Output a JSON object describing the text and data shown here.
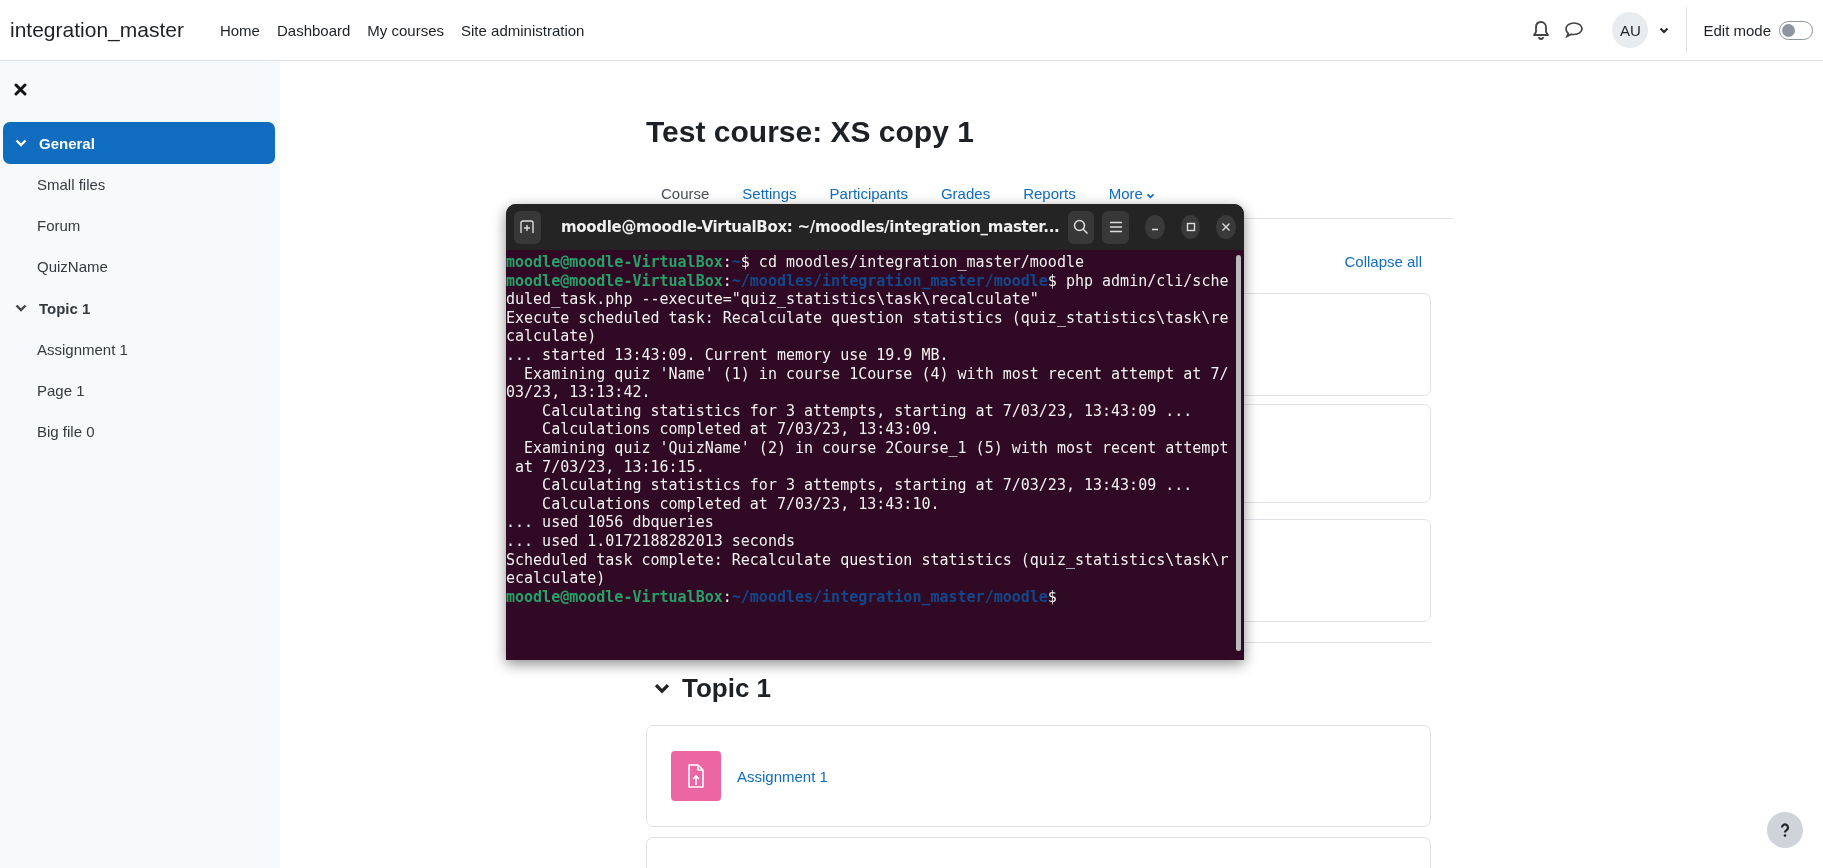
{
  "navbar": {
    "site_name": "integration_master",
    "links": [
      "Home",
      "Dashboard",
      "My courses",
      "Site administration"
    ],
    "avatar": "AU",
    "edit_mode": {
      "label": "Edit mode",
      "on": false
    }
  },
  "sidebar": {
    "sections": [
      {
        "title": "General",
        "expanded": true,
        "selected": true,
        "items": [
          "Small files",
          "Forum",
          "QuizName"
        ]
      },
      {
        "title": "Topic 1",
        "expanded": true,
        "selected": false,
        "items": [
          "Assignment 1",
          "Page 1",
          "Big file 0"
        ]
      }
    ]
  },
  "course": {
    "title": "Test course: XS copy 1",
    "tabs": [
      {
        "label": "Course",
        "selected": true
      },
      {
        "label": "Settings",
        "selected": false
      },
      {
        "label": "Participants",
        "selected": false
      },
      {
        "label": "Grades",
        "selected": false
      },
      {
        "label": "Reports",
        "selected": false
      },
      {
        "label": "More",
        "selected": false
      }
    ],
    "collapse_all": "Collapse all",
    "topic": {
      "title": "Topic 1",
      "expanded": true,
      "activities": [
        {
          "name": "Assignment 1",
          "kind": "assignment"
        }
      ]
    }
  },
  "terminal": {
    "title": "moodle@moodle-VirtualBox: ~/moodles/integration_master...",
    "lines": [
      {
        "kind": "prompt",
        "user": "moodle@moodle-VirtualBox",
        "sep": ":",
        "path": "~",
        "symbol": "$",
        "command": " cd moodles/integration_master/moodle"
      },
      {
        "kind": "prompt",
        "user": "moodle@moodle-VirtualBox",
        "sep": ":",
        "path": "~/moodles/integration_master/moodle",
        "symbol": "$",
        "command": " php admin/cli/sche"
      },
      {
        "kind": "output",
        "text": "duled_task.php --execute=\"quiz_statistics\\task\\recalculate\""
      },
      {
        "kind": "output",
        "text": "Execute scheduled task: Recalculate question statistics (quiz_statistics\\task\\re"
      },
      {
        "kind": "output",
        "text": "calculate)"
      },
      {
        "kind": "output",
        "text": "... started 13:43:09. Current memory use 19.9 MB."
      },
      {
        "kind": "output",
        "text": "  Examining quiz 'Name' (1) in course 1Course (4) with most recent attempt at 7/"
      },
      {
        "kind": "output",
        "text": "03/23, 13:13:42."
      },
      {
        "kind": "output",
        "text": "    Calculating statistics for 3 attempts, starting at 7/03/23, 13:43:09 ..."
      },
      {
        "kind": "output",
        "text": "    Calculations completed at 7/03/23, 13:43:09."
      },
      {
        "kind": "output",
        "text": "  Examining quiz 'QuizName' (2) in course 2Course_1 (5) with most recent attempt"
      },
      {
        "kind": "output",
        "text": " at 7/03/23, 13:16:15."
      },
      {
        "kind": "output",
        "text": "    Calculating statistics for 3 attempts, starting at 7/03/23, 13:43:09 ..."
      },
      {
        "kind": "output",
        "text": "    Calculations completed at 7/03/23, 13:43:10."
      },
      {
        "kind": "output",
        "text": "... used 1056 dbqueries"
      },
      {
        "kind": "output",
        "text": "... used 1.0172188282013 seconds"
      },
      {
        "kind": "output",
        "text": "Scheduled task complete: Recalculate question statistics (quiz_statistics\\task\\r"
      },
      {
        "kind": "output",
        "text": "ecalculate)"
      },
      {
        "kind": "prompt",
        "user": "moodle@moodle-VirtualBox",
        "sep": ":",
        "path": "~/moodles/integration_master/moodle",
        "symbol": "$"
      }
    ]
  }
}
